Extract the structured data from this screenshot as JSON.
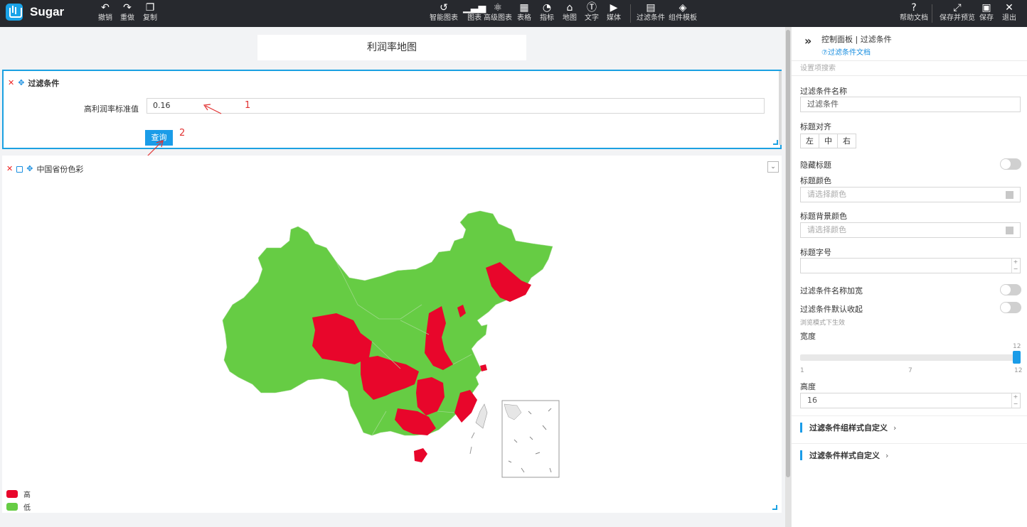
{
  "app": {
    "brand": "Sugar"
  },
  "toolbar": {
    "undo": "撤销",
    "redo": "重做",
    "copy": "复制",
    "smart_chart": "智能图表",
    "chart": "图表",
    "advanced_chart": "高级图表",
    "table": "表格",
    "indicator": "指标",
    "map": "地图",
    "text": "文字",
    "media": "媒体",
    "filter": "过滤条件",
    "component_template": "组件模板",
    "help": "帮助文档",
    "save_preview": "保存并预览",
    "save": "保存",
    "exit": "退出"
  },
  "page": {
    "title": "利润率地图"
  },
  "filter_panel": {
    "title": "过滤条件",
    "field_label": "高利润率标准值",
    "field_value": "0.16",
    "query_button": "查询",
    "annotation_1": "1",
    "annotation_2": "2"
  },
  "map_panel": {
    "title": "中国省份色彩",
    "legend": [
      {
        "label": "高",
        "color": "#e8062b"
      },
      {
        "label": "低",
        "color": "#66cc44"
      }
    ]
  },
  "side_panel": {
    "title": "控制面板 | 过滤条件",
    "doc_link": "⑦过滤条件文档",
    "search_placeholder": "设置项搜索",
    "name_label": "过滤条件名称",
    "name_value": "过滤条件",
    "align_label": "标题对齐",
    "align_options": [
      "左",
      "中",
      "右"
    ],
    "hide_title_label": "隐藏标题",
    "title_color_label": "标题颜色",
    "title_color_placeholder": "请选择颜色",
    "title_bg_label": "标题背景颜色",
    "title_bg_placeholder": "请选择颜色",
    "font_size_label": "标题字号",
    "font_size_value": "",
    "bold_label": "过滤条件名称加宽",
    "collapse_label": "过滤条件默认收起",
    "collapse_hint": "浏览模式下生效",
    "width_label": "宽度",
    "width_value": 12,
    "width_max_label": "12",
    "width_ticks": [
      "1",
      "7",
      "12"
    ],
    "height_label": "高度",
    "height_value": "16",
    "section_group_style": "过滤条件组样式自定义",
    "section_style": "过滤条件样式自定义"
  },
  "colors": {
    "accent": "#1a9ce8",
    "high": "#e8062b",
    "low": "#66cc44",
    "topbar": "#27292e"
  }
}
